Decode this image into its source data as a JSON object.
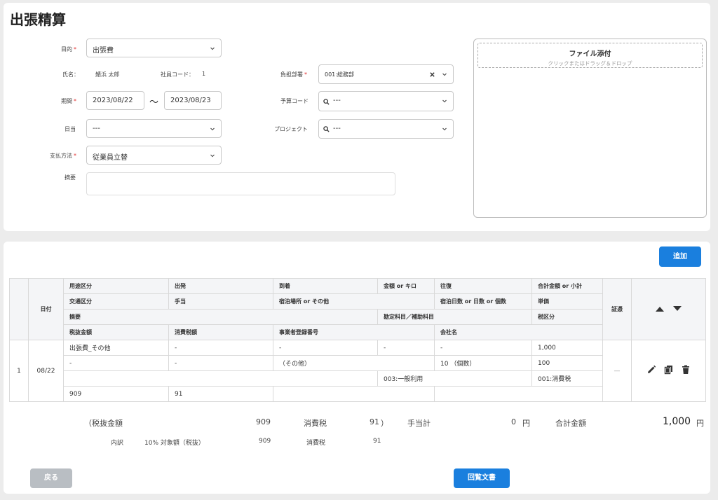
{
  "page": {
    "title": "出張精算"
  },
  "form": {
    "purpose": {
      "label": "目的",
      "value": "出張費"
    },
    "name": {
      "label": "氏名：",
      "value": "鯖浜 太郎"
    },
    "employee_code": {
      "label": "社員コード：",
      "value": "1"
    },
    "department": {
      "label": "負担部署",
      "value": "001:総務部"
    },
    "period": {
      "label": "期間",
      "from": "2023/08/22",
      "sep": "〜",
      "to": "2023/08/23"
    },
    "budget_code": {
      "label": "予算コード",
      "value": "---"
    },
    "allowance": {
      "label": "日当",
      "value": "---"
    },
    "project": {
      "label": "プロジェクト",
      "value": "---"
    },
    "payment": {
      "label": "支払方法",
      "value": "従業員立替"
    },
    "memo": {
      "label": "摘要",
      "value": ""
    },
    "required_mark": "*"
  },
  "attach": {
    "title": "ファイル添付",
    "hint": "クリックまたはドラッグ＆ドロップ"
  },
  "toolbar": {
    "add_label": "追加"
  },
  "table": {
    "date_header": "日付",
    "evidence_header": "証憑",
    "header_row1": [
      "用途区分",
      "出発",
      "到着",
      "金額 or キロ",
      "往復",
      "合計金額 or 小計"
    ],
    "header_row2": [
      "交通区分",
      "手当",
      "宿泊場所 or その他",
      "宿泊日数 or 日数 or 個数",
      "単価"
    ],
    "header_row3": [
      "摘要",
      "勘定科目／補助科目",
      "税区分"
    ],
    "header_row4": [
      "税抜金額",
      "消費税額",
      "事業者登録番号",
      "会社名"
    ],
    "rows": [
      {
        "no": "1",
        "date": "08/22",
        "evidence": "—",
        "r1": [
          "出張費_その他",
          "-",
          "-",
          "-",
          "-",
          "1,000"
        ],
        "r2": [
          "-",
          "-",
          "（その他）",
          "10 （個数）",
          "100"
        ],
        "r3": [
          "",
          "003:一般利用",
          "001:消費税"
        ],
        "r4": [
          "909",
          "91",
          "",
          ""
        ]
      }
    ]
  },
  "totals": {
    "open_paren": "（",
    "pretax_label": "税抜金額",
    "pretax_value": "909",
    "tax_label": "消費税",
    "tax_value": "91",
    "close_paren": "）",
    "allowance_label": "手当計",
    "allowance_value": "0",
    "yen": "円",
    "total_label": "合計金額",
    "total_value": "1,000",
    "breakdown_label": "内訳",
    "rate_label": "10% 対象額（税抜）",
    "rate_value": "909",
    "rate_tax_label": "消費税",
    "rate_tax_value": "91"
  },
  "footer": {
    "back_label": "戻る",
    "circulate_label": "回覧文書"
  }
}
